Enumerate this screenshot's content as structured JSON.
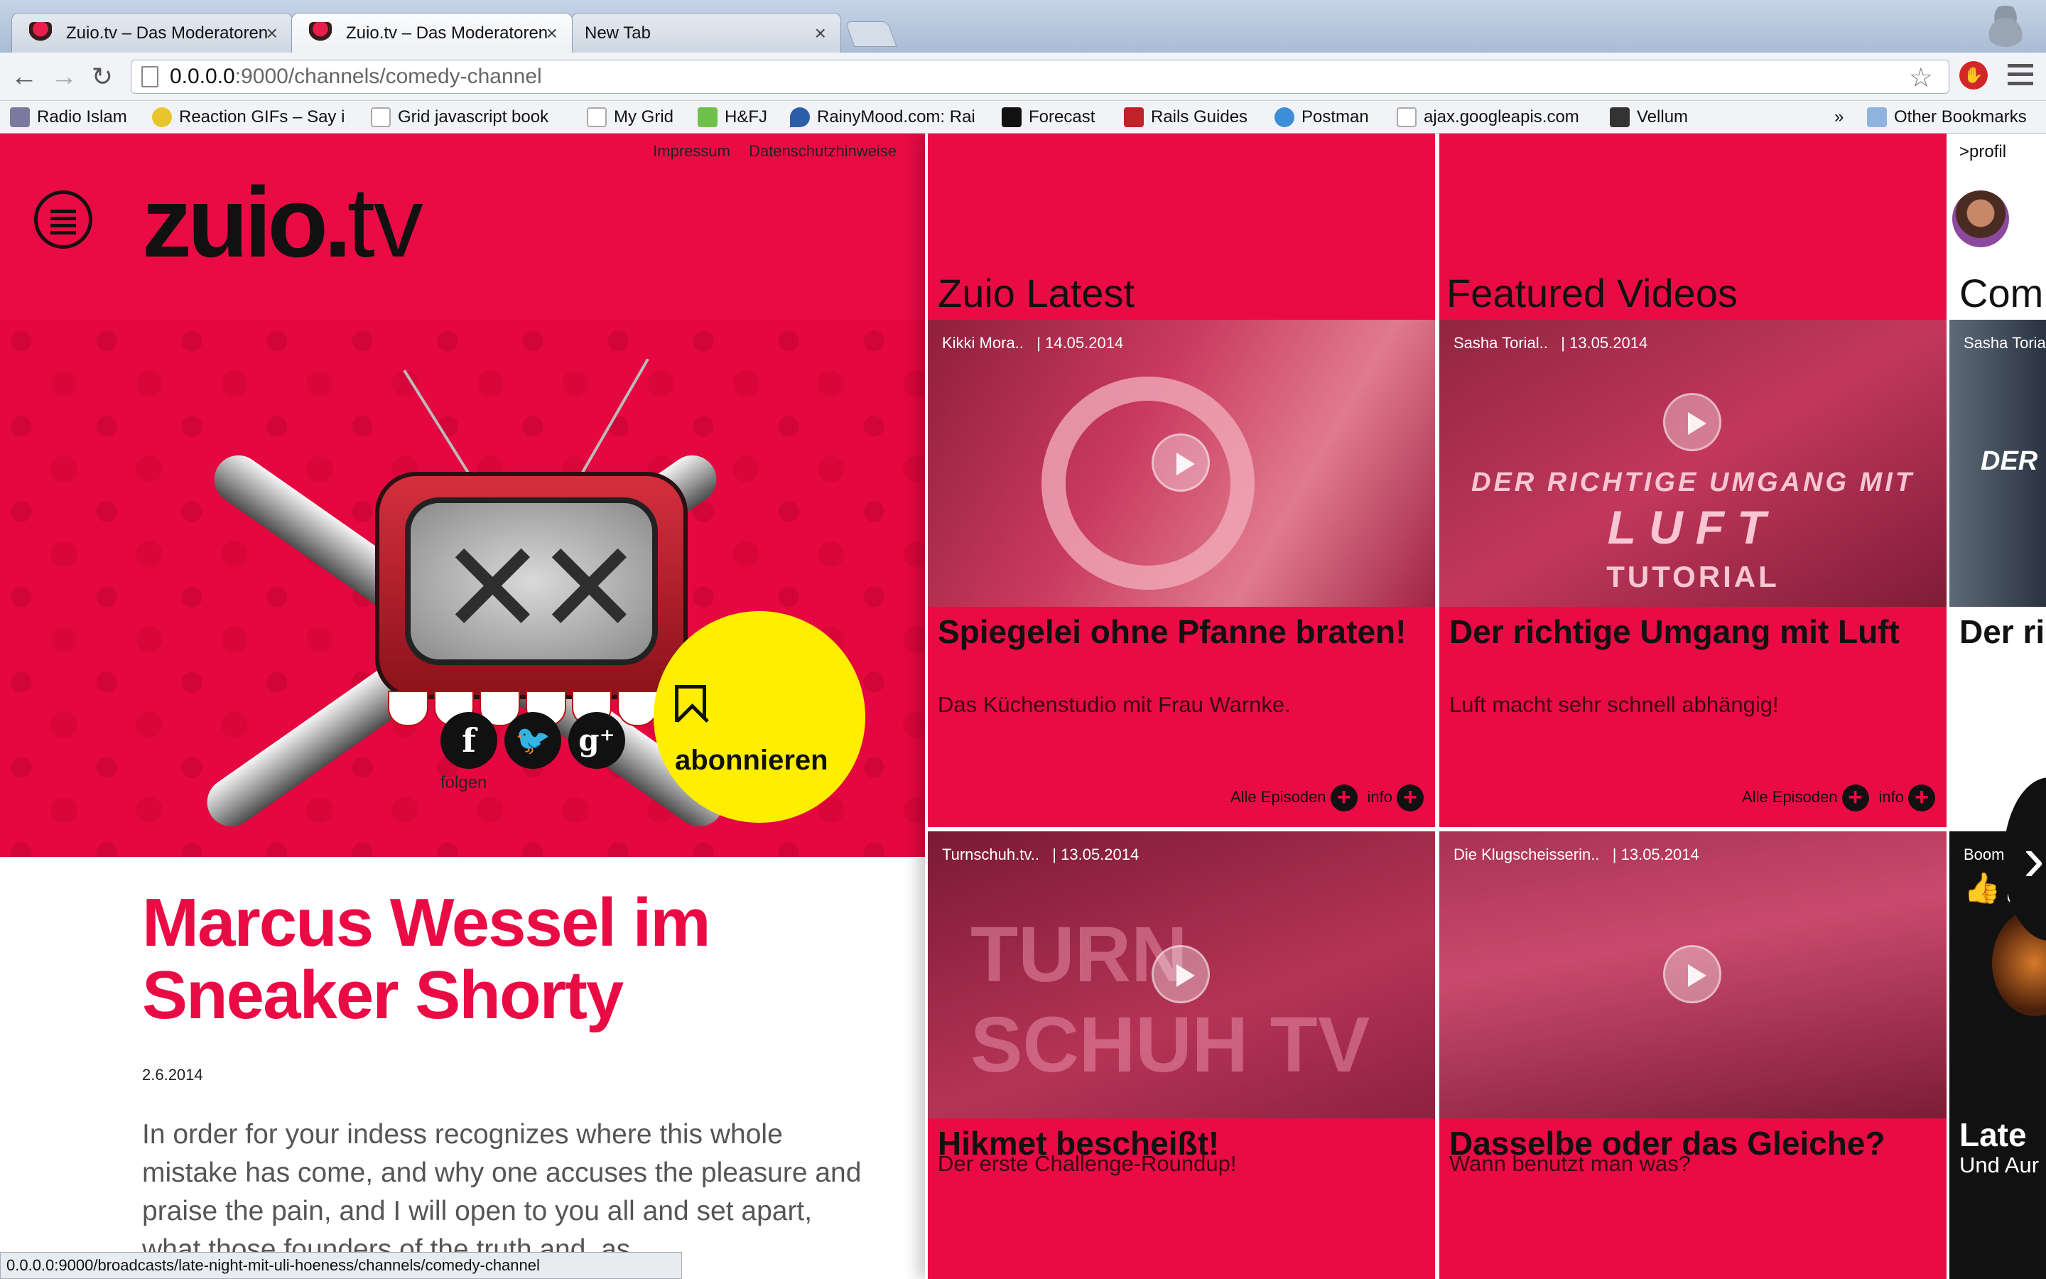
{
  "browser": {
    "tabs": [
      {
        "label": "Zuio.tv – Das Moderatoren",
        "close": "×"
      },
      {
        "label": "Zuio.tv – Das Moderatoren",
        "close": "×"
      },
      {
        "label": "New Tab",
        "close": "×"
      }
    ],
    "address": {
      "host": "0.0.0.0",
      "rest": ":9000/channels/comedy-channel"
    },
    "bookmarks": [
      {
        "label": "Radio Islam",
        "color": "#7a7aa0"
      },
      {
        "label": "Reaction GIFs – Say i",
        "color": "#e8c52c"
      },
      {
        "label": "Grid javascript book",
        "color": "#dddddd"
      },
      {
        "label": "My Grid",
        "color": "#dddddd"
      },
      {
        "label": "H&FJ",
        "color": "#6fc04b"
      },
      {
        "label": "RainyMood.com: Rai",
        "color": "#2c5ea8"
      },
      {
        "label": "Forecast",
        "color": "#111111"
      },
      {
        "label": "Rails Guides",
        "color": "#c0222a"
      },
      {
        "label": "Postman",
        "color": "#3c8fd6"
      },
      {
        "label": "ajax.googleapis.com",
        "color": "#dddddd"
      },
      {
        "label": "Vellum",
        "color": "#333333"
      }
    ],
    "bookmarks_more": "»",
    "other_bookmarks": "Other Bookmarks",
    "status_url": "0.0.0.0:9000/broadcasts/late-night-mit-uli-hoeness/channels/comedy-channel"
  },
  "site": {
    "toplinks": [
      "Impressum",
      "Datenschutzhinweise"
    ],
    "logo_main": "zuio",
    "logo_dot": ".",
    "logo_tv": "tv",
    "social_label": "folgen",
    "subscribe_label": "abonnieren",
    "article": {
      "title": "Marcus Wessel im Sneaker Shorty",
      "date": "2.6.2014",
      "body": "In order for your indess recognizes where this whole mistake has come, and why one accuses the pleasure and praise the pain, and I will open to you all and set apart, what those founders of the truth and, as"
    },
    "profil_link": ">profil",
    "columns": [
      {
        "title": "Zuio Latest",
        "cards": [
          {
            "author": "Kikki Mora..",
            "date": "| 14.05.2014",
            "title": "Spiegelei ohne Pfanne braten!",
            "subtitle": "Das Küchenstudio mit Frau Warnke.",
            "links": [
              "Alle Episoden",
              "info"
            ]
          },
          {
            "author": "Turnschuh.tv..",
            "date": "| 13.05.2014",
            "title": "Hikmet bescheißt!",
            "subtitle": "Der erste Challenge-Roundup!",
            "overlay": "TURN SCHUH TV"
          }
        ]
      },
      {
        "title": "Featured Videos",
        "cards": [
          {
            "author": "Sasha Torial..",
            "date": "| 13.05.2014",
            "title": "Der richtige Umgang mit Luft",
            "subtitle": "Luft macht sehr schnell abhängig!",
            "links": [
              "Alle Episoden",
              "info"
            ],
            "overlay_lines": [
              "DER RICHTIGE UMGANG MIT",
              "LUFT",
              "TUTORIAL"
            ]
          },
          {
            "author": "Die Klugscheisserin..",
            "date": "| 13.05.2014",
            "title": "Dasselbe oder das Gleiche?",
            "subtitle": "Wann benutzt man was?"
          }
        ]
      },
      {
        "title": "Com",
        "cards": [
          {
            "author": "Sasha Toria",
            "title": "Der ri",
            "overlay": "DER"
          },
          {
            "author": "Boomaram",
            "title": "Late",
            "subtitle": "Und Aur"
          }
        ]
      }
    ],
    "colors": {
      "brand": "#ea0b45",
      "accent": "#ffee00",
      "ink": "#111111"
    }
  }
}
